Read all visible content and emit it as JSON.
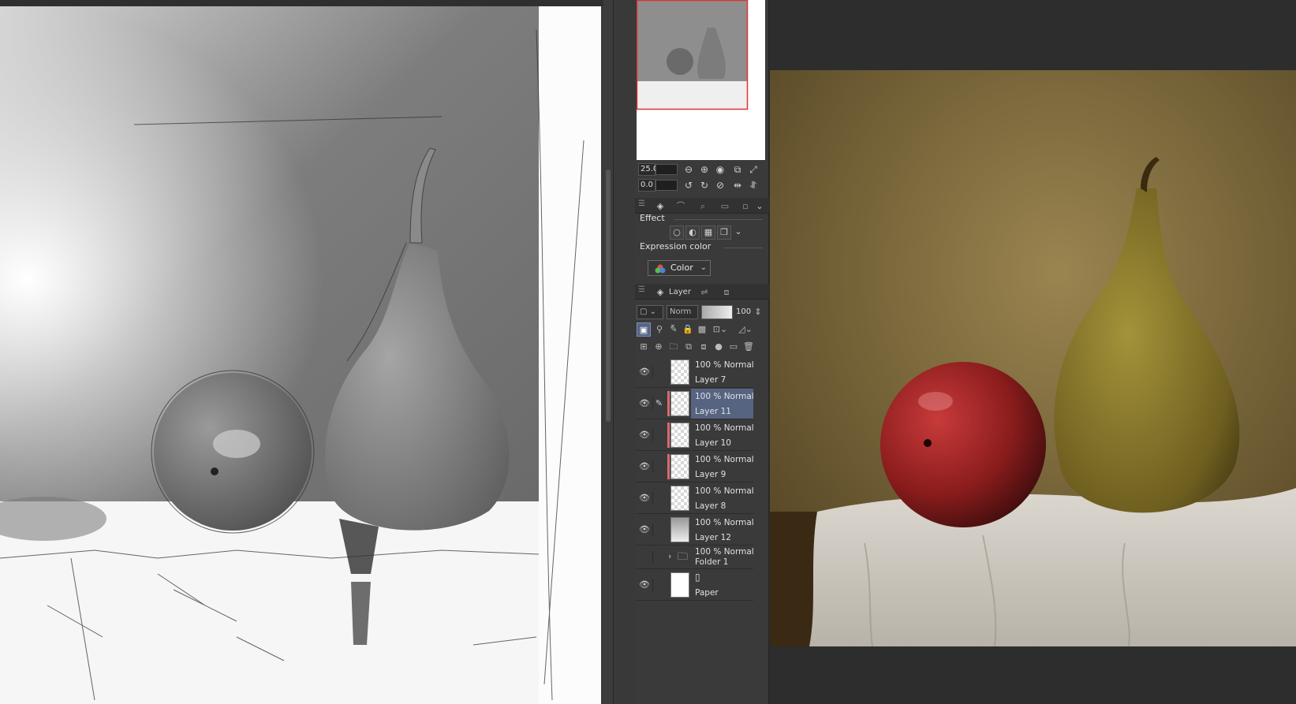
{
  "navigator": {
    "zoom": "25.0",
    "rotation": "0.0"
  },
  "sub_panel": {
    "effect_label": "Effect",
    "expression_color_label": "Expression color",
    "expression_color_value": "Color"
  },
  "layer_panel": {
    "tab_label": "Layer",
    "blend_mode": "Norm",
    "opacity": "100",
    "layers": [
      {
        "mode": "100 % Normal",
        "name": "Layer 7",
        "visible": true,
        "selected": false,
        "red_mark": false
      },
      {
        "mode": "100 % Normal",
        "name": "Layer 11",
        "visible": true,
        "selected": true,
        "red_mark": true
      },
      {
        "mode": "100 % Normal",
        "name": "Layer 10",
        "visible": true,
        "selected": false,
        "red_mark": true
      },
      {
        "mode": "100 % Normal",
        "name": "Layer 9",
        "visible": true,
        "selected": false,
        "red_mark": true
      },
      {
        "mode": "100 % Normal",
        "name": "Layer 8",
        "visible": true,
        "selected": false,
        "red_mark": false
      },
      {
        "mode": "100 % Normal",
        "name": "Layer 12",
        "visible": true,
        "selected": false,
        "red_mark": false
      },
      {
        "mode": "100 % Normal",
        "name": "Folder 1",
        "visible": false,
        "selected": false,
        "red_mark": false,
        "folder": true
      },
      {
        "mode": "",
        "name": "Paper",
        "visible": true,
        "selected": false,
        "red_mark": false,
        "paper": true
      }
    ]
  },
  "colors": {
    "selection": "#566482",
    "red_mark": "#d76b6b",
    "panel_bg": "#3a3a3a"
  }
}
